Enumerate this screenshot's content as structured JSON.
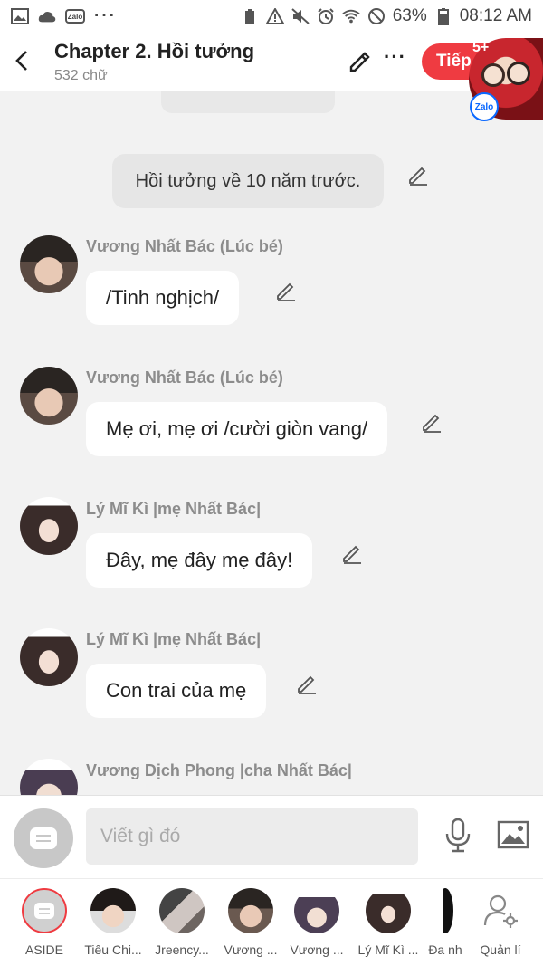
{
  "status_bar": {
    "battery": "63%",
    "time": "08:12 AM",
    "more": "···"
  },
  "header": {
    "title": "Chapter 2. Hồi tưởng",
    "subtitle": "532 chữ",
    "next_label": "Tiếp",
    "badge": "5+",
    "zalo_label": "Zalo"
  },
  "chat": {
    "narration": "Hồi tưởng về 10 năm trước.",
    "messages": [
      {
        "sender": "Vương Nhất Bác (Lúc bé)",
        "text": "/Tinh nghịch/"
      },
      {
        "sender": "Vương Nhất Bác (Lúc bé)",
        "text": "Mẹ ơi, mẹ ơi /cười giòn vang/"
      },
      {
        "sender": "Lý Mĩ Kì |mẹ Nhất Bác|",
        "text": "Đây, mẹ đây mẹ đây!"
      },
      {
        "sender": "Lý Mĩ Kì |mẹ Nhất Bác|",
        "text": "Con trai của mẹ"
      },
      {
        "sender": "Vương Dịch Phong |cha Nhất Bác|"
      }
    ]
  },
  "composer": {
    "placeholder": "Viết gì đó"
  },
  "characters": [
    {
      "label": "ASIDE"
    },
    {
      "label": "Tiêu Chi..."
    },
    {
      "label": "Jreency..."
    },
    {
      "label": "Vương ..."
    },
    {
      "label": "Vương ..."
    },
    {
      "label": "Lý Mĩ Kì ..."
    },
    {
      "label": "Đa nh"
    },
    {
      "label": "Quản lí"
    }
  ],
  "colors": {
    "accent": "#ef3b41",
    "background": "#f2f2f2",
    "sender_gray": "#8c8c8c"
  }
}
